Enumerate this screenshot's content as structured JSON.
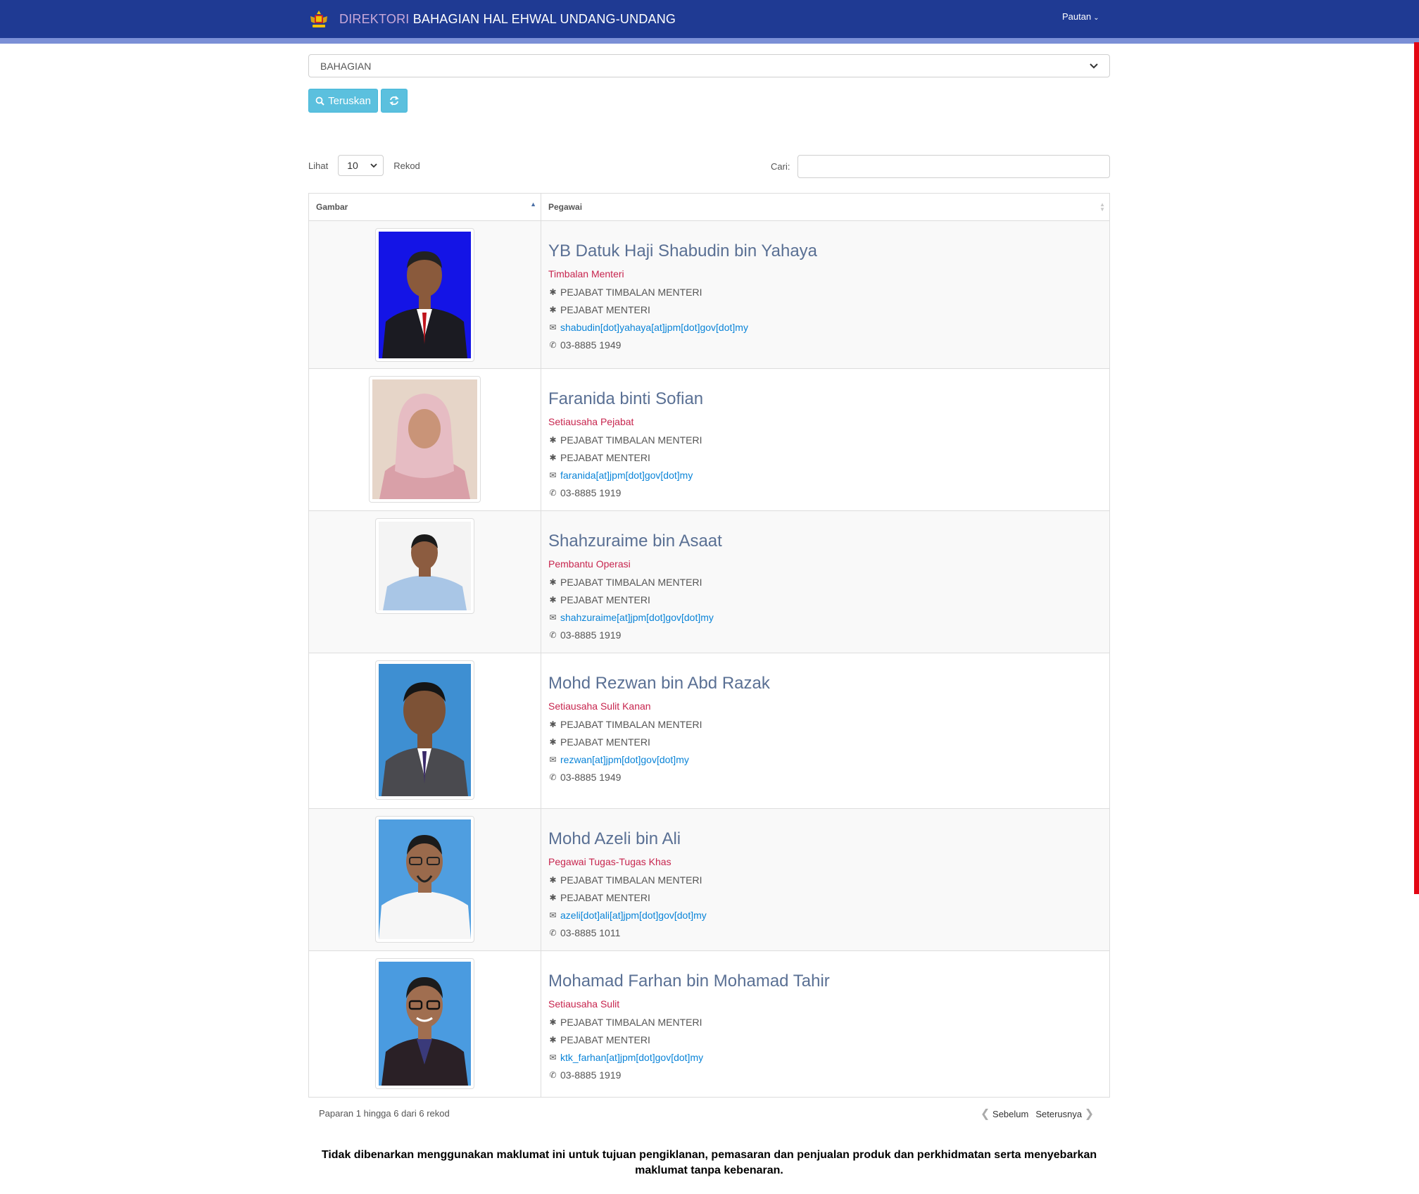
{
  "navbar": {
    "brand_accent": "DIREKTORI",
    "brand_rest": "BAHAGIAN HAL EHWAL UNDANG-UNDANG",
    "pautan_label": "Pautan",
    "colors": {
      "bg": "#1f3a93",
      "strip": "#7b8fd6"
    }
  },
  "filter": {
    "bahagian_selected": "BAHAGIAN",
    "teruskan_label": "Teruskan"
  },
  "table_controls": {
    "lihat_label": "Lihat",
    "page_length": "10",
    "rekod_label": "Rekod",
    "cari_label": "Cari:",
    "search_value": ""
  },
  "table": {
    "headers": [
      "Gambar",
      "Pegawai"
    ],
    "rows": [
      {
        "name": "YB Datuk Haji Shabudin bin Yahaya",
        "jawatan": "Timbalan Menteri",
        "unit1": "PEJABAT TIMBALAN MENTERI",
        "unit2": "PEJABAT MENTERI",
        "email": "shabudin[dot]yahaya[at]jpm[dot]gov[dot]my",
        "phone": "03-8885 1949",
        "photo_bg": "#1414e6",
        "suit": "#1b1b22",
        "skin": "#8a5a3c"
      },
      {
        "name": "Faranida binti Sofian",
        "jawatan": "Setiausaha Pejabat",
        "unit1": "PEJABAT TIMBALAN MENTERI",
        "unit2": "PEJABAT MENTERI",
        "email": "faranida[at]jpm[dot]gov[dot]my",
        "phone": " 03-8885 1919",
        "photo_bg": "#e6d5c8",
        "suit": "#d9a0a8",
        "skin": "#c99478"
      },
      {
        "name": "Shahzuraime bin Asaat",
        "jawatan": "Pembantu Operasi",
        "unit1": "PEJABAT TIMBALAN MENTERI",
        "unit2": "PEJABAT MENTERI",
        "email": "shahzuraime[at]jpm[dot]gov[dot]my",
        "phone": " 03-8885 1919",
        "photo_bg": "#f4f4f4",
        "suit": "#a9c6e6",
        "skin": "#8c5c40"
      },
      {
        "name": "Mohd Rezwan bin Abd Razak",
        "jawatan": "Setiausaha Sulit Kanan",
        "unit1": "PEJABAT TIMBALAN MENTERI",
        "unit2": "PEJABAT MENTERI",
        "email": "rezwan[at]jpm[dot]gov[dot]my",
        "phone": "03-8885 1949",
        "photo_bg": "#3e8fd2",
        "suit": "#4a4a4f",
        "skin": "#7d5236"
      },
      {
        "name": "Mohd Azeli bin Ali",
        "jawatan": "Pegawai Tugas-Tugas Khas",
        "unit1": "PEJABAT TIMBALAN MENTERI",
        "unit2": "PEJABAT MENTERI",
        "email": "azeli[dot]ali[at]jpm[dot]gov[dot]my",
        "phone": "03-8885 1011",
        "photo_bg": "#4f9ee0",
        "suit": "#f6f6f6",
        "skin": "#9a6a4c"
      },
      {
        "name": "Mohamad Farhan bin Mohamad Tahir",
        "jawatan": "Setiausaha Sulit",
        "unit1": "PEJABAT TIMBALAN MENTERI",
        "unit2": "PEJABAT MENTERI",
        "email": "ktk_farhan[at]jpm[dot]gov[dot]my",
        "phone": "03-8885 1919",
        "photo_bg": "#4a9be0",
        "suit": "#2a2026",
        "skin": "#a06e50"
      }
    ]
  },
  "footer": {
    "info": "Paparan 1 hingga 6 dari 6 rekod",
    "prev_label": "Sebelum",
    "next_label": "Seterusnya",
    "disclaimer": "Tidak dibenarkan menggunakan maklumat ini untuk tujuan pengiklanan, pemasaran dan penjualan produk dan perkhidmatan serta menyebarkan maklumat tanpa kebenaran."
  }
}
